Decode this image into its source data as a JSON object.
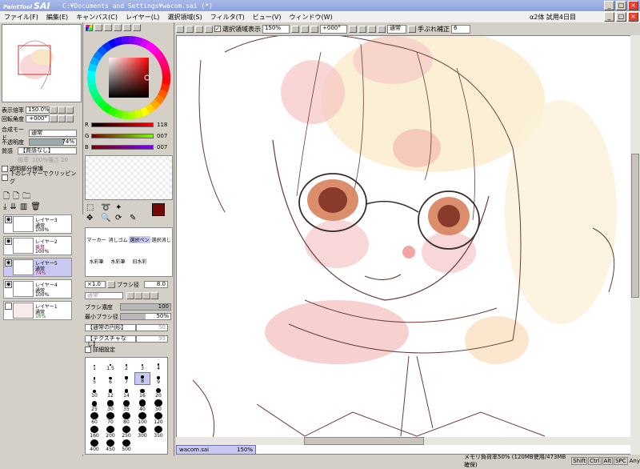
{
  "app": {
    "logo_small": "PaintTool",
    "logo_big": "SAI",
    "window_title": "C:¥Documents and Settings¥wacom.sai (*)"
  },
  "menu": [
    "ファイル(F)",
    "編集(E)",
    "キャンバス(C)",
    "レイヤー(L)",
    "選択領域(S)",
    "フィルタ(T)",
    "ビュー(V)",
    "ウィンドウ(W)"
  ],
  "trial": "α2体 試用4日目",
  "navigator": {
    "zoom_label": "表示倍率",
    "zoom_value": "150.0%",
    "angle_label": "回転角度",
    "angle_value": "+000°"
  },
  "layers_panel": {
    "blend_label": "合成モード",
    "blend_value": "通常",
    "opacity_label": "不透明度",
    "opacity_value": "74%",
    "texture_label": "質感",
    "texture_value": "【質感なし】",
    "texture_scale": "倍率",
    "texture_scale_value": "100%",
    "texture_strength": "強さ",
    "texture_strength_value": "20",
    "preserve_opacity": "透明部分保護",
    "clip_label": "下のレイヤーでクリッピング",
    "layers": [
      {
        "name": "レイヤー3",
        "mode": "通常",
        "opacity": "100%",
        "selected": false
      },
      {
        "name": "レイヤー2",
        "mode": "乗算",
        "opacity": "100%",
        "selected": false
      },
      {
        "name": "レイヤー5",
        "mode": "通常",
        "opacity": "74%",
        "selected": true
      },
      {
        "name": "レイヤー4",
        "mode": "通常",
        "opacity": "100%",
        "selected": false
      },
      {
        "name": "レイヤー1",
        "mode": "通常",
        "opacity": "16%",
        "selected": false
      }
    ]
  },
  "colors": {
    "rgb_r_label": "R",
    "rgb_r": "118",
    "rgb_g_label": "G",
    "rgb_g": "007",
    "rgb_b_label": "B",
    "rgb_b": "007",
    "foreground": "#760707"
  },
  "tools": {
    "row1": [
      "マーカー",
      "消しゴム",
      "選択ペン",
      "選択消し"
    ],
    "row2": [
      "水彩筆",
      "水彩筆",
      "旧水彩"
    ],
    "size_mult": "×1.0",
    "size_label": "ブラシ径",
    "size_value": "8.0",
    "mode_label": "通常",
    "density_label": "ブラシ濃度",
    "density_value": "100",
    "min_size_label": "最小ブラシ径",
    "min_size_value": "50%",
    "shape_label": "【通常の円形】",
    "shape_value": "50",
    "texture_label": "【テクスチャなし】",
    "texture_value": "95",
    "detail_label": "詳細設定",
    "brush_sizes": [
      "1",
      "1.5",
      "2",
      "3",
      "4",
      "5",
      "6",
      "7",
      "8",
      "9",
      "10",
      "12",
      "14",
      "16",
      "20",
      "25",
      "30",
      "35",
      "40",
      "50",
      "60",
      "70",
      "80",
      "100",
      "120",
      "160",
      "200",
      "250",
      "300",
      "350",
      "400",
      "450",
      "500"
    ],
    "selected_brush": "8"
  },
  "canvas_toolbar": {
    "selection_label": "選択領域表示",
    "zoom": "150%",
    "rotation": "+000°",
    "mode": "通常",
    "stabilizer_label": "手ぶれ補正",
    "stabilizer_value": "6"
  },
  "doc_tab": {
    "name": "wacom.sai",
    "zoom": "150%"
  },
  "status": {
    "memory": "メモリ負荷率50% (120MB使用/473MB確保)",
    "keys": [
      "Shift",
      "Ctrl",
      "Alt",
      "SPC"
    ],
    "any": "Any"
  }
}
